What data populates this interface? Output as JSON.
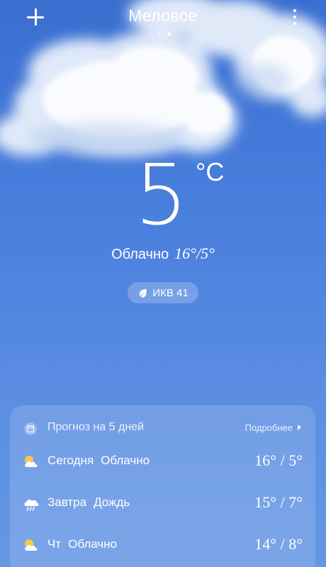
{
  "header": {
    "city": "Меловое",
    "add_icon": "plus-icon",
    "menu_icon": "more-vertical-icon",
    "location_icon": "location-arrow-icon"
  },
  "current": {
    "temperature": "5",
    "unit": "°C",
    "condition": "Облачно",
    "range": "16°/5°",
    "aqi_label": "ИКВ 41",
    "aqi_icon": "leaf-icon"
  },
  "forecast": {
    "title": "Прогноз на 5 дней",
    "more_label": "Подробнее",
    "calendar_icon": "calendar-icon",
    "days": [
      {
        "day": "Сегодня",
        "condition": "Облачно",
        "temps": "16° / 5°",
        "icon": "partly-cloudy-icon"
      },
      {
        "day": "Завтра",
        "condition": "Дождь",
        "temps": "15° / 7°",
        "icon": "rain-cloud-icon"
      },
      {
        "day": "Чт",
        "condition": "Облачно",
        "temps": "14° / 8°",
        "icon": "partly-cloudy-icon"
      }
    ]
  },
  "colors": {
    "background_top": "#3a6fd0",
    "background_bottom": "#6597e4",
    "text": "#ffffff"
  }
}
